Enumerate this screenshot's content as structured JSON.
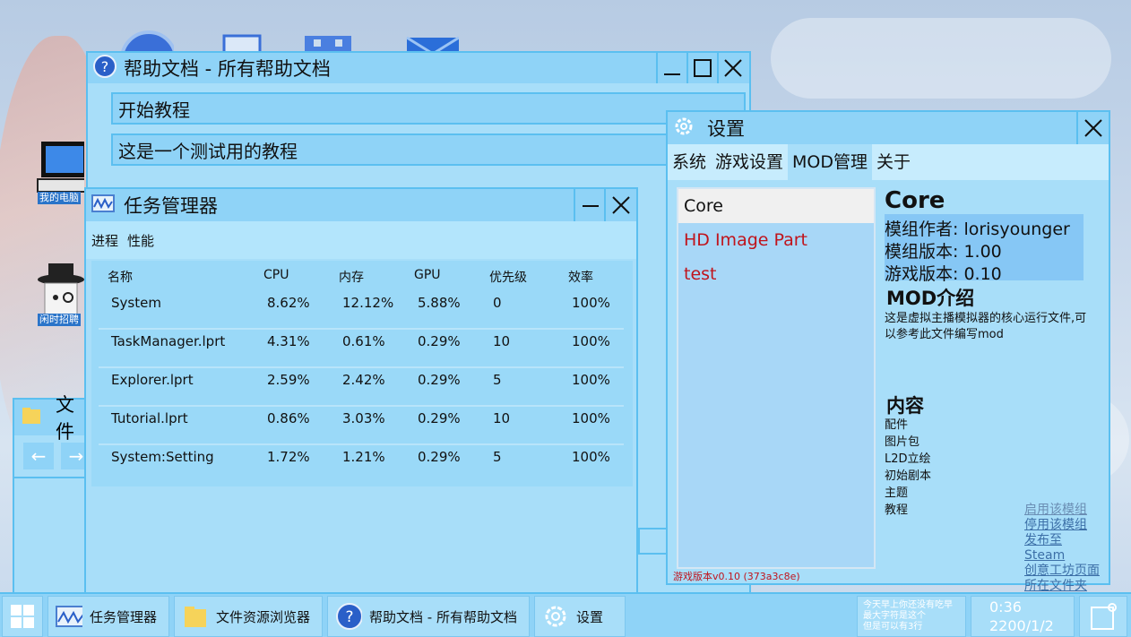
{
  "desktop": {
    "icons": [
      {
        "label": "我的电脑"
      },
      {
        "label": "闲时招聘"
      }
    ]
  },
  "help_window": {
    "title": "帮助文档 - 所有帮助文档",
    "items": [
      "开始教程",
      "这是一个测试用的教程"
    ]
  },
  "taskmgr": {
    "title": "任务管理器",
    "tabs": [
      "进程",
      "性能"
    ],
    "columns": [
      "名称",
      "CPU",
      "内存",
      "GPU",
      "优先级",
      "效率"
    ],
    "rows": [
      {
        "name": "System",
        "cpu": "8.62%",
        "mem": "12.12%",
        "gpu": "5.88%",
        "priority": "0",
        "eff": "100%"
      },
      {
        "name": "TaskManager.lprt",
        "cpu": "4.31%",
        "mem": "0.61%",
        "gpu": "0.29%",
        "priority": "10",
        "eff": "100%"
      },
      {
        "name": "Explorer.lprt",
        "cpu": "2.59%",
        "mem": "2.42%",
        "gpu": "0.29%",
        "priority": "5",
        "eff": "100%"
      },
      {
        "name": "Tutorial.lprt",
        "cpu": "0.86%",
        "mem": "3.03%",
        "gpu": "0.29%",
        "priority": "10",
        "eff": "100%"
      },
      {
        "name": "System:Setting",
        "cpu": "1.72%",
        "mem": "1.21%",
        "gpu": "0.29%",
        "priority": "5",
        "eff": "100%"
      }
    ]
  },
  "settings": {
    "title": "设置",
    "tabs": [
      "系统",
      "游戏设置",
      "MOD管理",
      "关于"
    ],
    "mods": [
      "Core",
      "HD Image Part",
      "test"
    ],
    "detail": {
      "name": "Core",
      "author": "模组作者: lorisyounger",
      "mod_version": "模组版本: 1.00",
      "game_version": "游戏版本: 0.10",
      "intro_title": "MOD介绍",
      "intro": "这是虚拟主播模拟器的核心运行文件,可以参考此文件编写mod",
      "content_title": "内容",
      "contents": [
        "配件",
        "图片包",
        "L2D立绘",
        "初始剧本",
        "主题",
        "教程"
      ]
    },
    "links": [
      "启用该模组",
      "停用该模组",
      "发布至Steam",
      "创意工坊页面",
      "所在文件夹"
    ],
    "footer": "游戏版本v0.10 (373a3c8e)",
    "colors": {
      "disabled_mod": "#c0141c"
    }
  },
  "explorer": {
    "title_partial": "文件"
  },
  "taskbar": {
    "items": [
      "任务管理器",
      "文件资源浏览器",
      "帮助文档 - 所有帮助文档",
      "设置"
    ],
    "notice": [
      "今天早上你还没有吃早",
      "最大字符是这个",
      "但是可以有3行"
    ],
    "time": "0:36",
    "date": "2200/1/2"
  }
}
